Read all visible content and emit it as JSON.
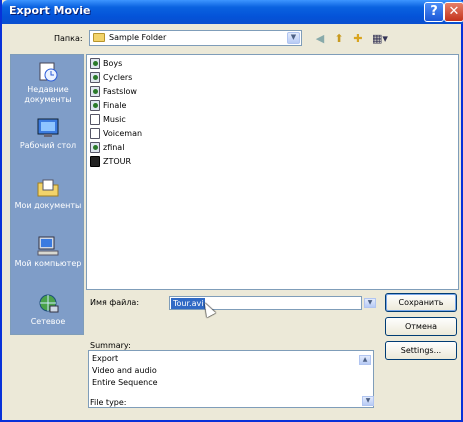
{
  "window": {
    "title": "Export Movie",
    "help": "?",
    "close": "✕"
  },
  "folder": {
    "label": "Папка:",
    "value": "Sample Folder"
  },
  "places": [
    {
      "label": "Недавние документы",
      "icon": "recent-documents-icon"
    },
    {
      "label": "Рабочий стол",
      "icon": "desktop-icon"
    },
    {
      "label": "Мои документы",
      "icon": "my-documents-icon"
    },
    {
      "label": "Мой компьютер",
      "icon": "my-computer-icon"
    },
    {
      "label": "Сетевое",
      "icon": "network-icon"
    }
  ],
  "files": [
    {
      "name": "Boys",
      "icon": "movie"
    },
    {
      "name": "Cyclers",
      "icon": "movie"
    },
    {
      "name": "Fastslow",
      "icon": "movie"
    },
    {
      "name": "Finale",
      "icon": "movie"
    },
    {
      "name": "Music",
      "icon": "doc"
    },
    {
      "name": "Voiceman",
      "icon": "doc"
    },
    {
      "name": "zfinal",
      "icon": "movie"
    },
    {
      "name": "ZTOUR",
      "icon": "film"
    }
  ],
  "filename": {
    "label": "Имя файла:",
    "value": "Tour.avi"
  },
  "buttons": {
    "save": "Сохранить",
    "cancel": "Отмена",
    "settings": "Settings..."
  },
  "summary": {
    "label": "Summary:",
    "lines": [
      "Export",
      "Video and audio",
      "Entire Sequence"
    ]
  },
  "filetype": {
    "label": "File type:"
  },
  "colors": {
    "titlebar": "#0453d8",
    "selection": "#316ac5",
    "places_bar": "#7f9dc8"
  }
}
